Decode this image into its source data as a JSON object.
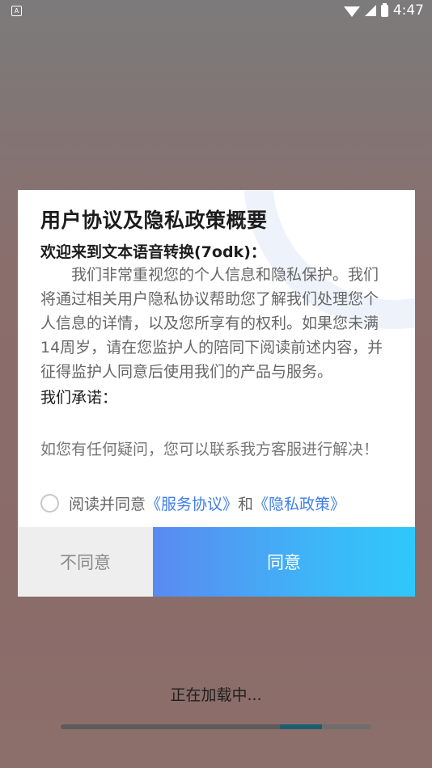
{
  "status_bar": {
    "left_badge": "A",
    "time": "4:47"
  },
  "dialog": {
    "title": "用户协议及隐私政策概要",
    "welcome": "欢迎来到文本语音转换(7odk)：",
    "body": "我们非常重视您的个人信息和隐私保护。我们将通过相关用户隐私协议帮助您了解我们处理您个人信息的详情，以及您所享有的权利。如果您未满14周岁，请在您监护人的陪同下阅读前述内容，并征得监护人同意后使用我们的产品与服务。",
    "promise_heading": "我们承诺：",
    "contact": "如您有任何疑问，您可以联系我方客服进行解决！",
    "agree_prefix": "阅读并同意",
    "service_link": "《服务协议》",
    "and_text": "和",
    "privacy_link": "《隐私政策》",
    "disagree_label": "不同意",
    "agree_label": "同意"
  },
  "loading": {
    "text": "正在加载中...",
    "progress": 0.84
  }
}
